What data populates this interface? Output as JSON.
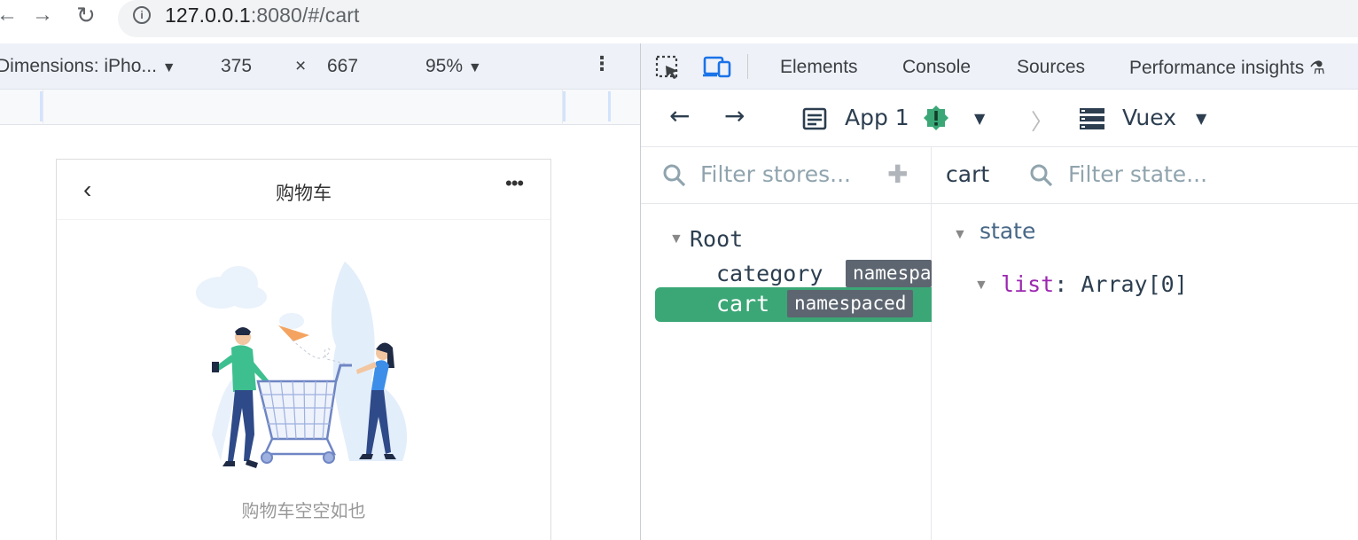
{
  "browser": {
    "url_host": "127.0.0.1",
    "url_rest": ":8080/#/cart"
  },
  "device_toolbar": {
    "dimensions_label": "Dimensions: iPho...",
    "width": "375",
    "times": "×",
    "height": "667",
    "zoom": "95%"
  },
  "page": {
    "title": "购物车",
    "empty_text": "购物车空空如也"
  },
  "devtools": {
    "tabs": [
      "Elements",
      "Console",
      "Sources",
      "Performance insights"
    ],
    "vue": {
      "app_label": "App 1",
      "plugin_label": "Vuex",
      "filter_stores_placeholder": "Filter stores...",
      "filter_state_placeholder": "Filter state...",
      "selected_store": "cart",
      "tree": {
        "root": "Root",
        "items": [
          {
            "label": "category",
            "tag": "namespaced"
          },
          {
            "label": "cart",
            "tag": "namespaced"
          }
        ]
      },
      "state": {
        "section": "state",
        "key": "list",
        "colon": ":",
        "value": "Array[0]"
      }
    }
  },
  "colors": {
    "accent_green": "#3ba776",
    "link_purple": "#9c27b0",
    "devtools_blue": "#1a73e8"
  }
}
